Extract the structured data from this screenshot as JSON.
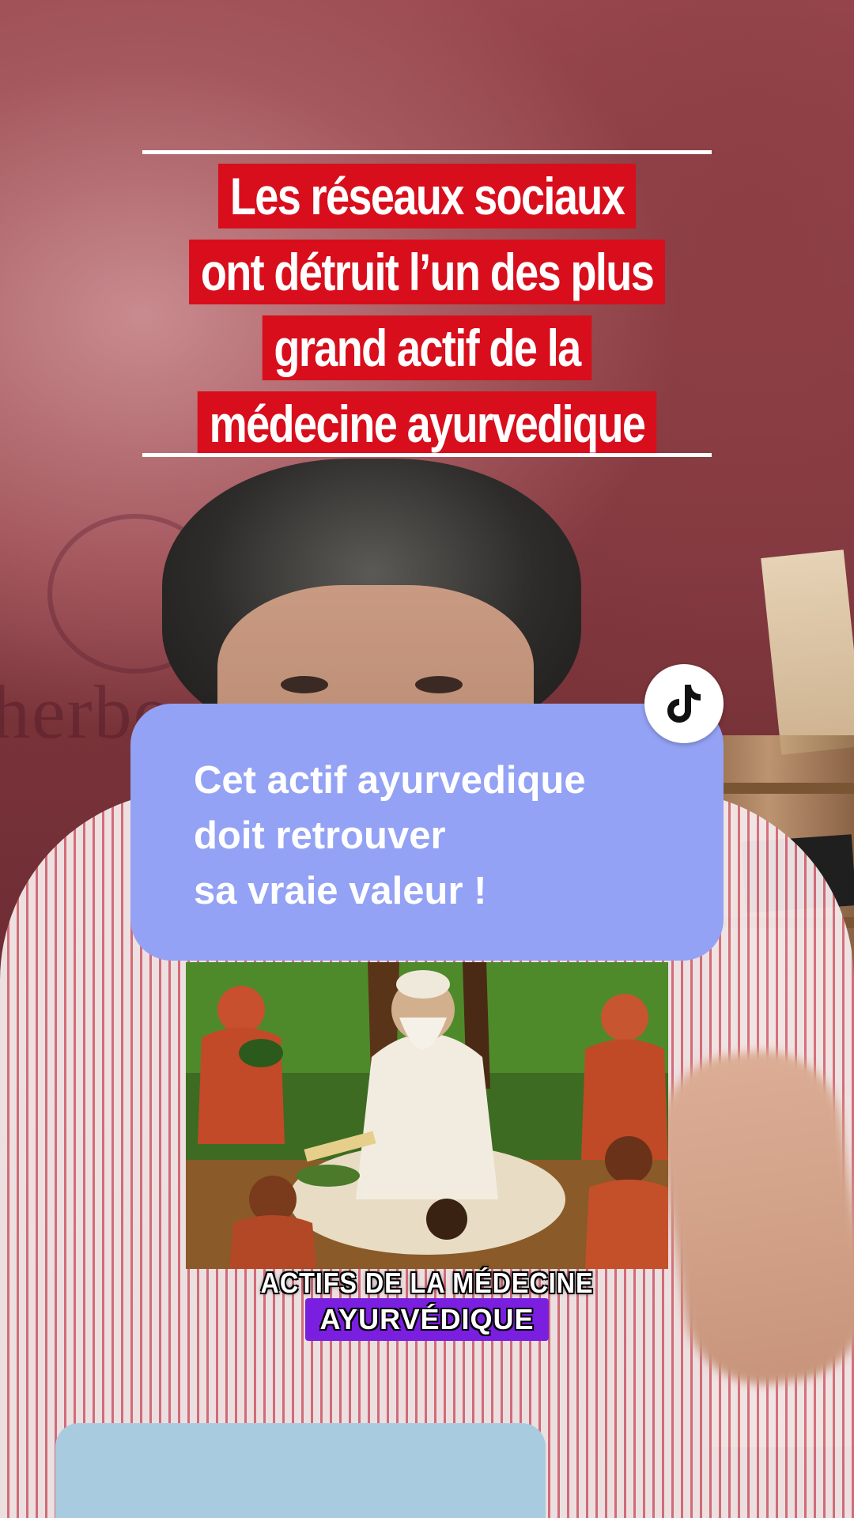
{
  "video": {
    "headline_lines": [
      "Les réseaux sociaux",
      "ont détruit l’un des plus",
      "grand actif de la",
      "médecine ayurvedique"
    ],
    "background_banner_text": "herbo"
  },
  "comment_bubble": {
    "lines": [
      "Cet actif ayurvedique",
      "doit retrouver",
      "sa vraie valeur !"
    ],
    "badge_icon": "tiktok-logo-icon"
  },
  "inset_image": {
    "description_icon": "ayurvedic-sage-painting"
  },
  "caption": {
    "line1": "ACTIFS DE LA MÉDECINE",
    "line2": "AYURVÉDIQUE",
    "highlight_color": "#7a1fe0"
  },
  "colors": {
    "headline_bg": "#d80e1c",
    "bubble_bg": "#93a2f4"
  }
}
